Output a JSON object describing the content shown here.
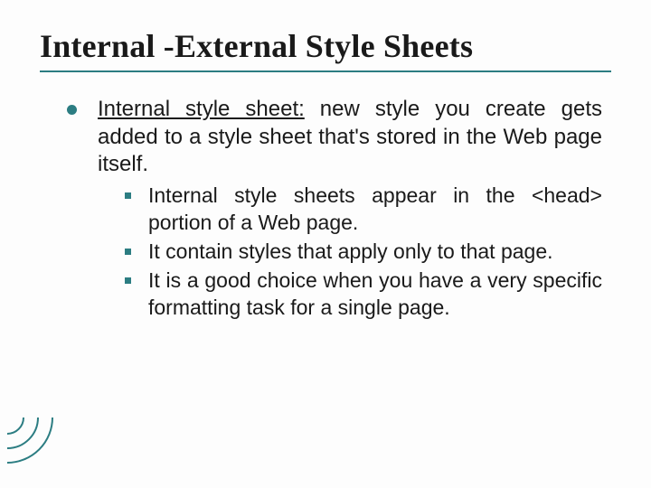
{
  "colors": {
    "accent": "#2c7d82",
    "text": "#1a1a1a"
  },
  "title": "Internal -External Style Sheets",
  "main": {
    "heading": "Internal style sheet:",
    "heading_rest": " new style you create gets added to a style sheet that's stored in the Web page itself.",
    "items": [
      "Internal style sheets appear in the <head> portion of a Web page.",
      "It contain styles that apply only to that page.",
      "It is a good choice when you have a very specific formatting task for a single page."
    ]
  }
}
